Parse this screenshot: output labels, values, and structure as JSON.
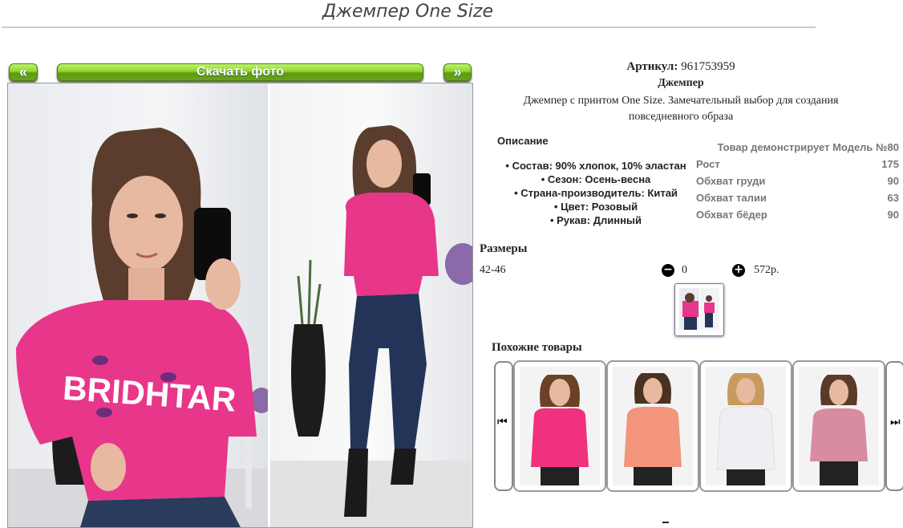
{
  "product": {
    "title": "Джемпер One Size",
    "sku_label": "Артикул:",
    "sku_value": "961753959",
    "name": "Джемпер",
    "description_line1": "Джемпер с принтом One Size. Замечательный выбор для создания",
    "description_line2": "повседневного образа"
  },
  "gallery": {
    "prev_label": "«",
    "download_label": "Скачать фото",
    "next_label": "»",
    "print_text": "BRIDHTAR",
    "brand_color": "#6fb31f",
    "sweater_color": "#e8368a"
  },
  "description": {
    "heading": "Описание",
    "items": [
      "Состав: 90% хлопок, 10% эластан",
      "Сезон: Осень-весна",
      "Страна-производитель: Китай",
      "Цвет: Розовый",
      "Рукав: Длинный"
    ]
  },
  "model": {
    "heading": "Товар демонстрирует Модель №80",
    "rows": [
      {
        "label": "Рост",
        "value": "175"
      },
      {
        "label": "Обхват груди",
        "value": "90"
      },
      {
        "label": "Обхват талии",
        "value": "63"
      },
      {
        "label": "Обхват бёдер",
        "value": "90"
      }
    ]
  },
  "sizes": {
    "heading": "Размеры",
    "size": "42-46",
    "quantity": "0",
    "price": "572р.",
    "minus_icon": "minus-circle-icon",
    "plus_icon": "plus-circle-icon"
  },
  "similar": {
    "heading": "Похожие товары",
    "prev_icon": "skip-back-icon",
    "next_icon": "skip-forward-icon",
    "colors": [
      "#f0317d",
      "#f2957b",
      "#f1eef3",
      "#d98ba0"
    ]
  }
}
